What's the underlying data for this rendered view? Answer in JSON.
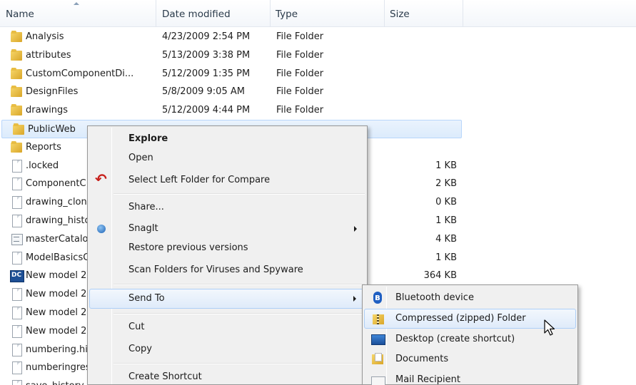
{
  "columns": {
    "name": "Name",
    "date": "Date modified",
    "type": "Type",
    "size": "Size"
  },
  "rows": [
    {
      "name": "Analysis",
      "date": "4/23/2009 2:54 PM",
      "type": "File Folder",
      "size": "",
      "icon": "folder-icon"
    },
    {
      "name": "attributes",
      "date": "5/13/2009 3:38 PM",
      "type": "File Folder",
      "size": "",
      "icon": "folder-icon"
    },
    {
      "name": "CustomComponentDi...",
      "date": "5/12/2009 1:35 PM",
      "type": "File Folder",
      "size": "",
      "icon": "folder-icon"
    },
    {
      "name": "DesignFiles",
      "date": "5/8/2009 9:05 AM",
      "type": "File Folder",
      "size": "",
      "icon": "folder-icon"
    },
    {
      "name": "drawings",
      "date": "5/12/2009 4:44 PM",
      "type": "File Folder",
      "size": "",
      "icon": "folder-icon"
    },
    {
      "name": "PublicWeb",
      "date": "",
      "type": "",
      "size": "",
      "icon": "folder-icon",
      "selected": true
    },
    {
      "name": "Reports",
      "date": "",
      "type": "",
      "size": "",
      "icon": "folder-icon"
    },
    {
      "name": ".locked",
      "date": "",
      "type": "",
      "size": "1 KB",
      "icon": "file-icon"
    },
    {
      "name": "ComponentC",
      "date": "",
      "type": "",
      "size": "2 KB",
      "icon": "file-icon"
    },
    {
      "name": "drawing_clon",
      "date": "",
      "type": "",
      "size": "0 KB",
      "icon": "file-icon"
    },
    {
      "name": "drawing_histc",
      "date": "",
      "type": "",
      "size": "1 KB",
      "icon": "file-icon"
    },
    {
      "name": "masterCatalo",
      "date": "",
      "type": "",
      "size": "4 KB",
      "icon": "catalog-icon"
    },
    {
      "name": "ModelBasicsC",
      "date": "",
      "type": "",
      "size": "1 KB",
      "icon": "file-icon"
    },
    {
      "name": "New model 2",
      "date": "",
      "type": "",
      "size": "364 KB",
      "icon": "model-icon"
    },
    {
      "name": "New model 2",
      "date": "",
      "type": "",
      "size": "",
      "icon": "file-icon"
    },
    {
      "name": "New model 2",
      "date": "",
      "type": "",
      "size": "",
      "icon": "file-icon"
    },
    {
      "name": "New model 2",
      "date": "",
      "type": "",
      "size": "",
      "icon": "file-icon"
    },
    {
      "name": "numbering.hi",
      "date": "",
      "type": "",
      "size": "",
      "icon": "file-icon"
    },
    {
      "name": "numberingres",
      "date": "",
      "type": "",
      "size": "",
      "icon": "file-icon"
    },
    {
      "name": "save_history",
      "date": "",
      "type": "",
      "size": "",
      "icon": "file-icon"
    }
  ],
  "context_menu": {
    "explore": "Explore",
    "open": "Open",
    "compare": "Select Left Folder for Compare",
    "share": "Share...",
    "snagit": "SnagIt",
    "restore": "Restore previous versions",
    "scan": "Scan Folders for Viruses and Spyware",
    "send_to": "Send To",
    "cut": "Cut",
    "copy": "Copy",
    "create_shortcut": "Create Shortcut"
  },
  "send_to_menu": {
    "bluetooth": "Bluetooth device",
    "zip": "Compressed (zipped) Folder",
    "desktop": "Desktop (create shortcut)",
    "documents": "Documents",
    "mail": "Mail Recipient"
  },
  "colors": {
    "selection": "#dcebfc",
    "menu_background": "#f0f0f0",
    "hover_border": "#aecff7"
  }
}
